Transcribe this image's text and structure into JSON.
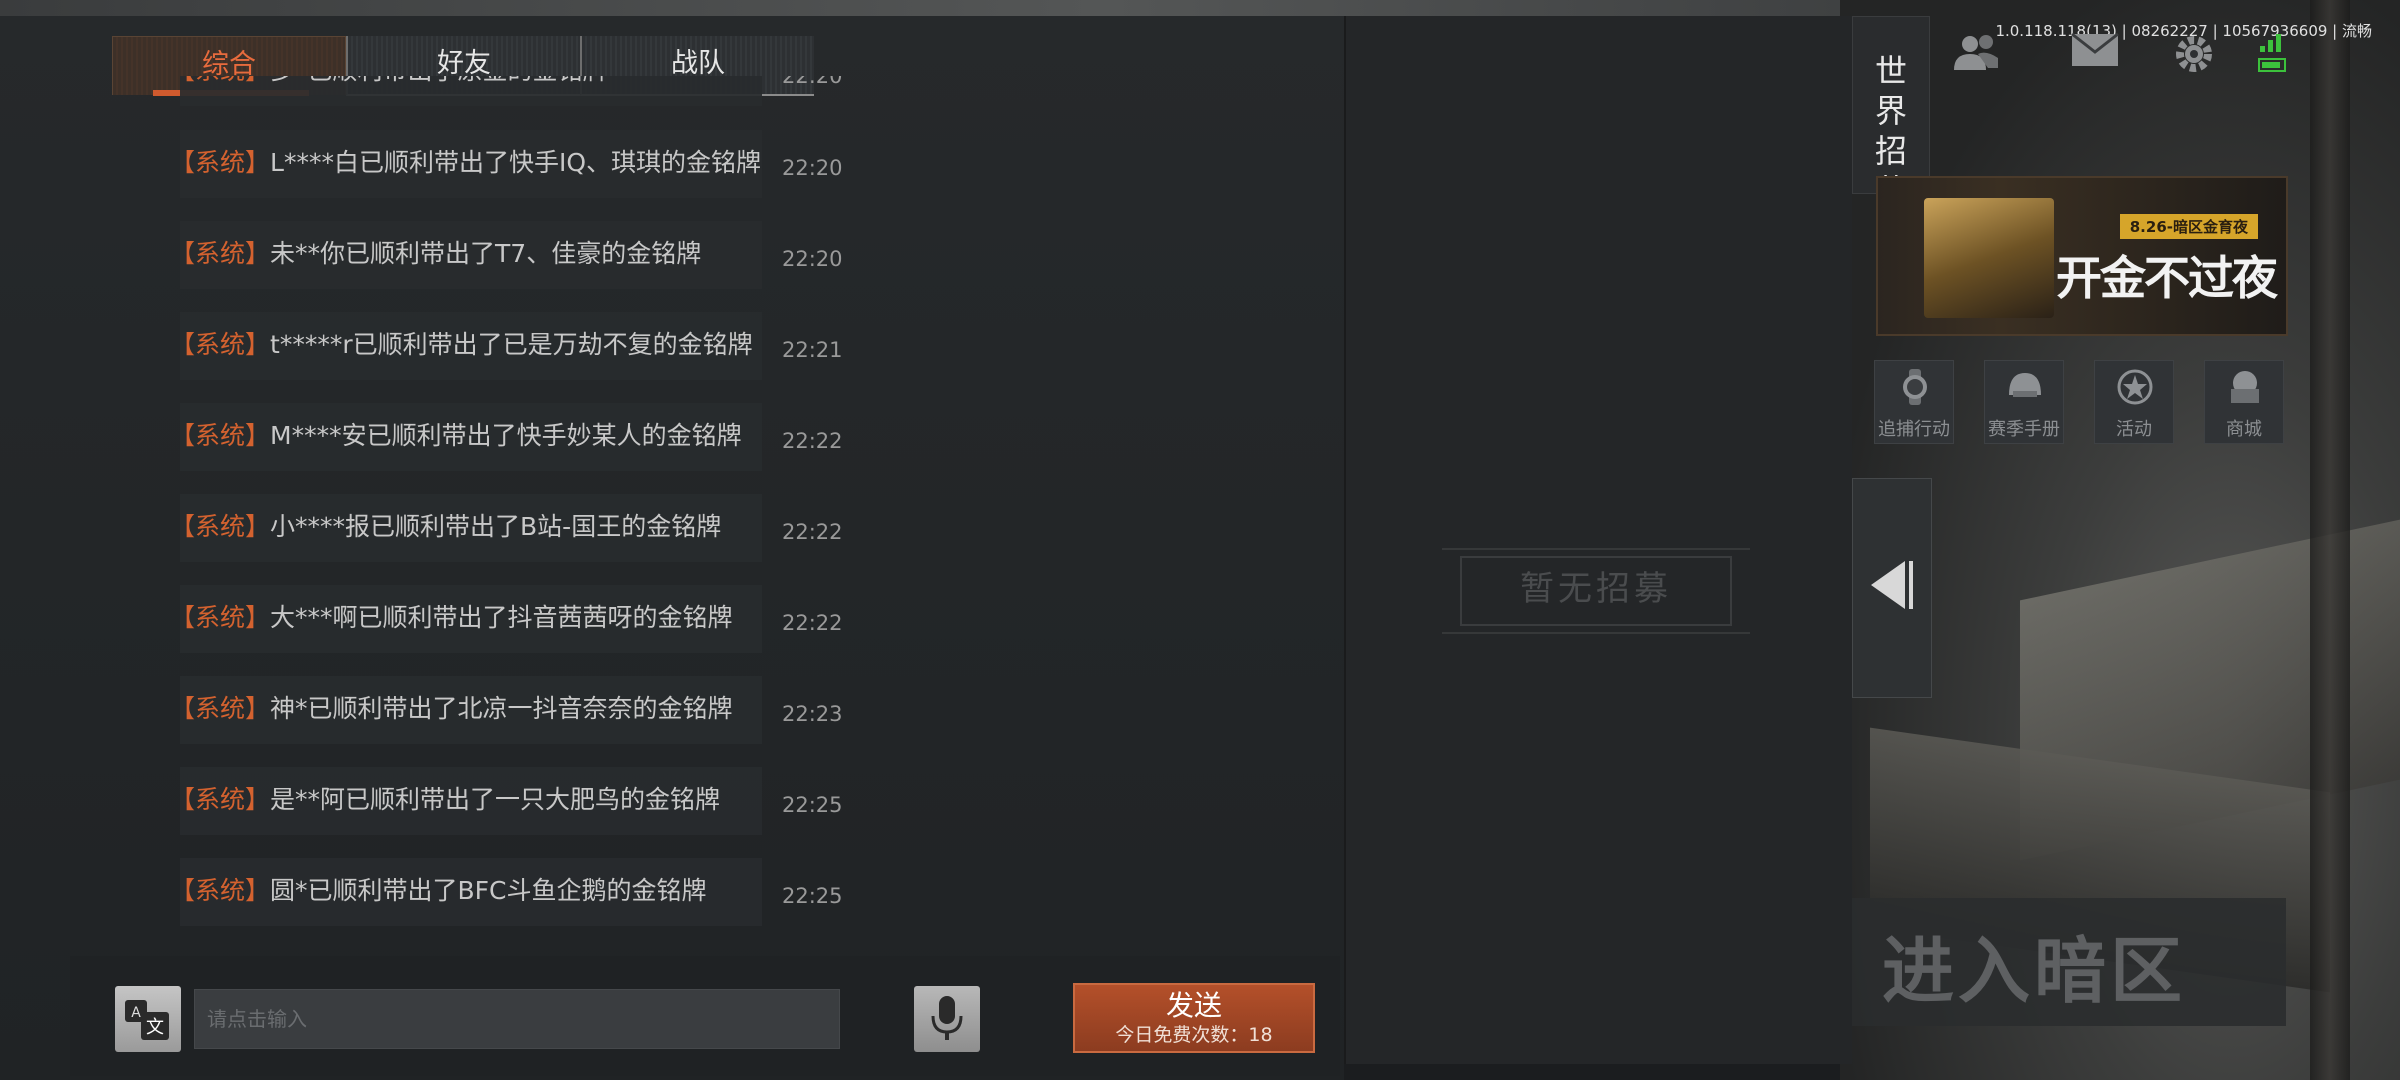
{
  "tabs": [
    {
      "label": "综合",
      "active": true
    },
    {
      "label": "好友",
      "active": false
    },
    {
      "label": "战队",
      "active": false
    }
  ],
  "messages": [
    {
      "tag": "【系统】",
      "text": "多*已顺利带出了原金的金铭牌",
      "time": "22:20"
    },
    {
      "tag": "【系统】",
      "text": "L****白已顺利带出了快手IQ、琪琪的金铭牌",
      "time": "22:20"
    },
    {
      "tag": "【系统】",
      "text": "未**你已顺利带出了T7、佳豪的金铭牌",
      "time": "22:20"
    },
    {
      "tag": "【系统】",
      "text": "t*****r已顺利带出了已是万劫不复的金铭牌",
      "time": "22:21"
    },
    {
      "tag": "【系统】",
      "text": "M****安已顺利带出了快手妙某人的金铭牌",
      "time": "22:22"
    },
    {
      "tag": "【系统】",
      "text": "小****报已顺利带出了B站-国王的金铭牌",
      "time": "22:22"
    },
    {
      "tag": "【系统】",
      "text": "大***啊已顺利带出了抖音茜茜呀的金铭牌",
      "time": "22:22"
    },
    {
      "tag": "【系统】",
      "text": "神*已顺利带出了北凉一抖音奈奈的金铭牌",
      "time": "22:23"
    },
    {
      "tag": "【系统】",
      "text": "是**阿已顺利带出了一只大肥鸟的金铭牌",
      "time": "22:25"
    },
    {
      "tag": "【系统】",
      "text": "圆*已顺利带出了BFC斗鱼企鹅的金铭牌",
      "time": "22:25"
    }
  ],
  "input": {
    "placeholder": "请点击输入",
    "value": ""
  },
  "send": {
    "label": "发送",
    "quota": "今日免费次数：18"
  },
  "recruit": {
    "tab_label": [
      "世",
      "界",
      "招",
      "募"
    ],
    "empty_text": "暂无招募"
  },
  "status": {
    "version": "1.0.118.118(13) | 08262227 | 10567936609 | 流畅"
  },
  "banner": {
    "badge": "8.26-暗区金育夜",
    "title": "开金不过夜"
  },
  "quick_menu": [
    {
      "label": "追捕行动",
      "icon": "watch-icon"
    },
    {
      "label": "赛季手册",
      "icon": "helmet-icon"
    },
    {
      "label": "活动",
      "icon": "star-icon"
    },
    {
      "label": "商城",
      "icon": "shop-icon"
    }
  ],
  "enter": {
    "label": "进入暗区"
  },
  "colors": {
    "accent": "#d4622f",
    "send_bg": "#a0462a",
    "signal": "#3cc23c"
  }
}
